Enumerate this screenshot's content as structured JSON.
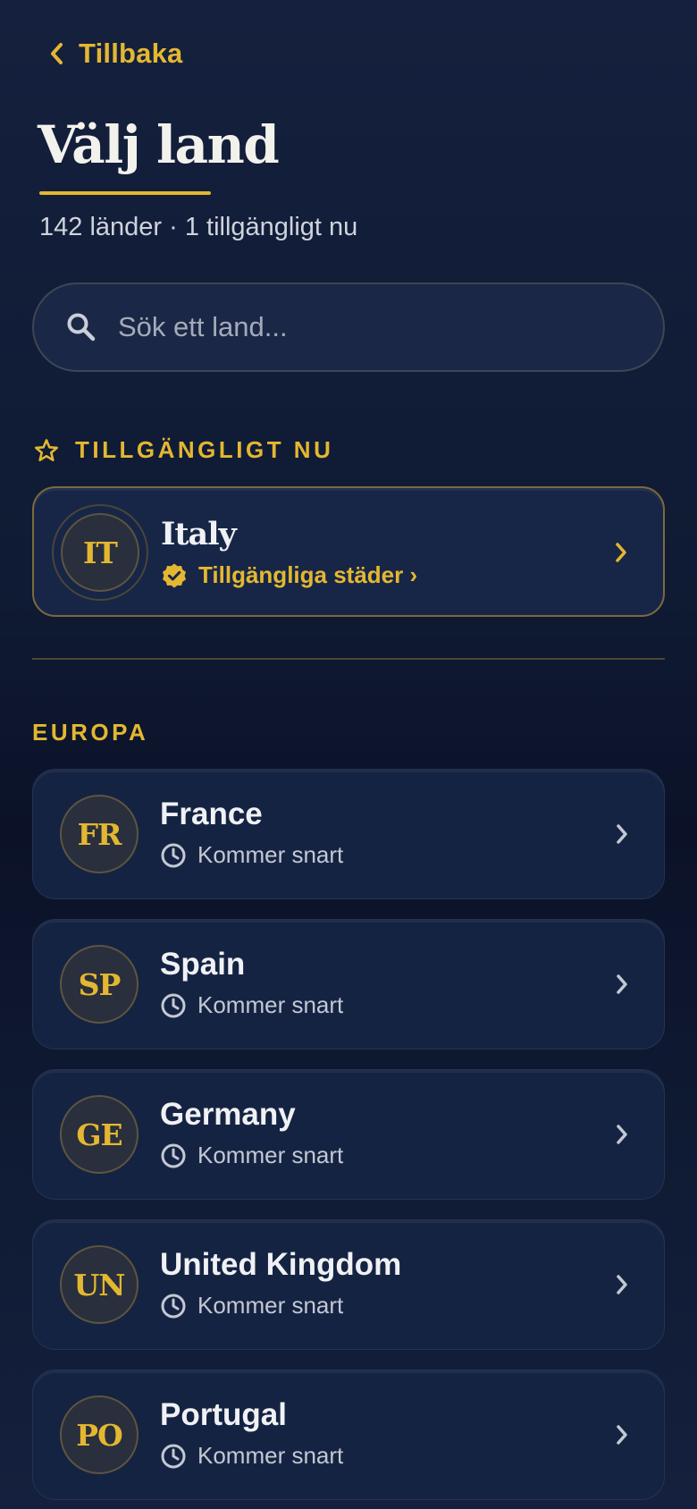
{
  "nav": {
    "back_label": "Tillbaka"
  },
  "header": {
    "title": "Välj land",
    "subtitle": "142 länder · 1 tillgängligt nu"
  },
  "search": {
    "placeholder": "Sök ett land...",
    "value": ""
  },
  "available_section": {
    "heading": "TILLGÄNGLIGT NU",
    "country": {
      "code": "IT",
      "name": "Italy",
      "status": "Tillgängliga städer ›"
    }
  },
  "region": {
    "heading": "EUROPA",
    "countries": [
      {
        "code": "FR",
        "name": "France",
        "status": "Kommer snart"
      },
      {
        "code": "SP",
        "name": "Spain",
        "status": "Kommer snart"
      },
      {
        "code": "GE",
        "name": "Germany",
        "status": "Kommer snart"
      },
      {
        "code": "UN",
        "name": "United Kingdom",
        "status": "Kommer snart"
      },
      {
        "code": "PO",
        "name": "Portugal",
        "status": "Kommer snart"
      }
    ]
  },
  "colors": {
    "accent": "#e4b731",
    "background": "#0f1a33",
    "card": "#152343"
  },
  "icons": [
    "chevron-left-icon",
    "search-icon",
    "star-icon",
    "verified-check-icon",
    "clock-icon",
    "chevron-right-icon"
  ]
}
